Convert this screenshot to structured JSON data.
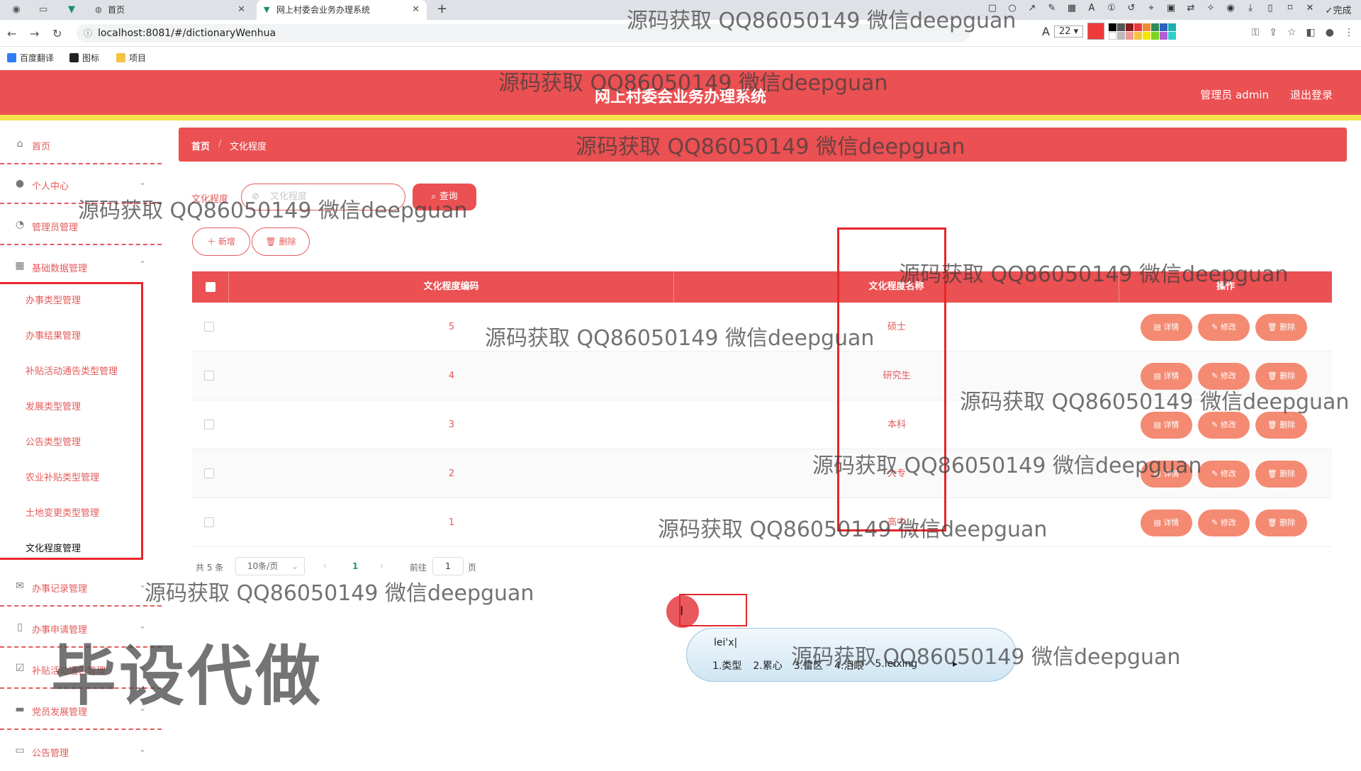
{
  "browser": {
    "tabs": [
      {
        "title": "首页",
        "active": false
      },
      {
        "title": "网上村委会业务办理系统",
        "active": true
      }
    ],
    "url": "localhost:8081/#/dictionaryWenhua",
    "font_size_value": "22",
    "bookmarks": [
      "百度翻译",
      "图标",
      "项目"
    ],
    "snip_done_label": "完成"
  },
  "header": {
    "title": "网上村委会业务办理系统",
    "user_label": "管理员 admin",
    "logout_label": "退出登录"
  },
  "sidebar": {
    "menus": [
      {
        "label": "首页",
        "icon": "home-icon"
      },
      {
        "label": "个人中心",
        "icon": "user-icon"
      },
      {
        "label": "管理员管理",
        "icon": "admin-icon"
      },
      {
        "label": "基础数据管理",
        "icon": "grid-icon"
      }
    ],
    "submenu": [
      "办事类型管理",
      "办事结果管理",
      "补贴活动通告类型管理",
      "发展类型管理",
      "公告类型管理",
      "农业补贴类型管理",
      "土地变更类型管理",
      "文化程度管理"
    ],
    "bottom_menus": [
      {
        "label": "办事记录管理",
        "icon": "mail-icon"
      },
      {
        "label": "办事申请管理",
        "icon": "mic-icon"
      },
      {
        "label": "补贴活动通告管理",
        "icon": "check-icon"
      },
      {
        "label": "党员发展管理",
        "icon": "monitor-icon"
      },
      {
        "label": "公告管理",
        "icon": "chat-icon"
      }
    ]
  },
  "breadcrumb": {
    "home": "首页",
    "current": "文化程度"
  },
  "search": {
    "label": "文化程度",
    "placeholder": "文化程度",
    "query_button": "查询",
    "add_button": "新增",
    "delete_button": "删除"
  },
  "table": {
    "columns": [
      "文化程度编码",
      "文化程度名称",
      "操作"
    ],
    "rows": [
      {
        "code": "5",
        "name": "硕士"
      },
      {
        "code": "4",
        "name": "研究生"
      },
      {
        "code": "3",
        "name": "本科"
      },
      {
        "code": "2",
        "name": "大专"
      },
      {
        "code": "1",
        "name": "高中"
      }
    ],
    "actions": {
      "detail": "详情",
      "edit": "修改",
      "delete": "删除"
    }
  },
  "pagination": {
    "total_text": "共 5 条",
    "page_size": "10条/页",
    "current_page": "1",
    "goto_label": "前往",
    "goto_value": "1",
    "page_suffix": "页"
  },
  "ime": {
    "composition": "lei'x|",
    "candidates": [
      "1.类型",
      "2.累心",
      "3.雷区",
      "4.泪眼",
      "5.leixing"
    ]
  },
  "watermark": {
    "text": "源码获取 QQ86050149 微信deepguan",
    "big_text": "毕设代做"
  },
  "colors": {
    "primary": "#eb5052",
    "accent_yellow": "#f4e24b",
    "action_orange": "#f48a72",
    "highlight_red": "#e5262b"
  }
}
